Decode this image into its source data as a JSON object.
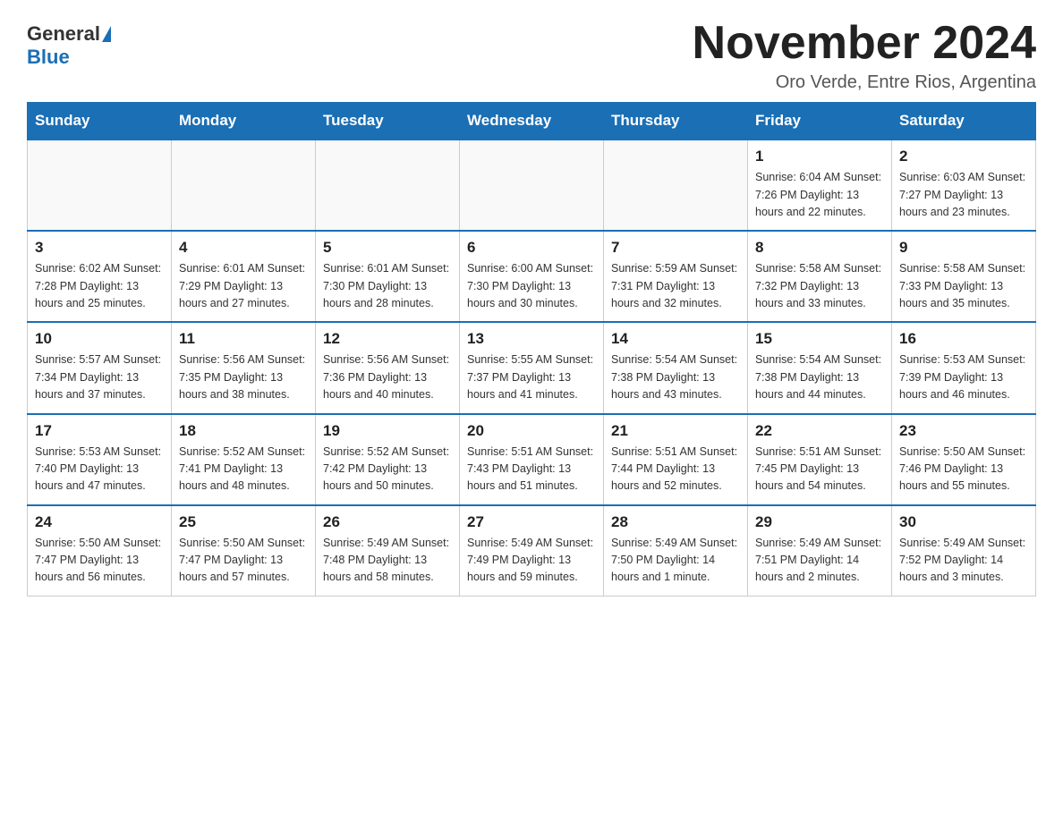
{
  "logo": {
    "general": "General",
    "blue": "Blue"
  },
  "title": "November 2024",
  "subtitle": "Oro Verde, Entre Rios, Argentina",
  "days_of_week": [
    "Sunday",
    "Monday",
    "Tuesday",
    "Wednesday",
    "Thursday",
    "Friday",
    "Saturday"
  ],
  "weeks": [
    [
      {
        "day": "",
        "info": ""
      },
      {
        "day": "",
        "info": ""
      },
      {
        "day": "",
        "info": ""
      },
      {
        "day": "",
        "info": ""
      },
      {
        "day": "",
        "info": ""
      },
      {
        "day": "1",
        "info": "Sunrise: 6:04 AM\nSunset: 7:26 PM\nDaylight: 13 hours and 22 minutes."
      },
      {
        "day": "2",
        "info": "Sunrise: 6:03 AM\nSunset: 7:27 PM\nDaylight: 13 hours and 23 minutes."
      }
    ],
    [
      {
        "day": "3",
        "info": "Sunrise: 6:02 AM\nSunset: 7:28 PM\nDaylight: 13 hours and 25 minutes."
      },
      {
        "day": "4",
        "info": "Sunrise: 6:01 AM\nSunset: 7:29 PM\nDaylight: 13 hours and 27 minutes."
      },
      {
        "day": "5",
        "info": "Sunrise: 6:01 AM\nSunset: 7:30 PM\nDaylight: 13 hours and 28 minutes."
      },
      {
        "day": "6",
        "info": "Sunrise: 6:00 AM\nSunset: 7:30 PM\nDaylight: 13 hours and 30 minutes."
      },
      {
        "day": "7",
        "info": "Sunrise: 5:59 AM\nSunset: 7:31 PM\nDaylight: 13 hours and 32 minutes."
      },
      {
        "day": "8",
        "info": "Sunrise: 5:58 AM\nSunset: 7:32 PM\nDaylight: 13 hours and 33 minutes."
      },
      {
        "day": "9",
        "info": "Sunrise: 5:58 AM\nSunset: 7:33 PM\nDaylight: 13 hours and 35 minutes."
      }
    ],
    [
      {
        "day": "10",
        "info": "Sunrise: 5:57 AM\nSunset: 7:34 PM\nDaylight: 13 hours and 37 minutes."
      },
      {
        "day": "11",
        "info": "Sunrise: 5:56 AM\nSunset: 7:35 PM\nDaylight: 13 hours and 38 minutes."
      },
      {
        "day": "12",
        "info": "Sunrise: 5:56 AM\nSunset: 7:36 PM\nDaylight: 13 hours and 40 minutes."
      },
      {
        "day": "13",
        "info": "Sunrise: 5:55 AM\nSunset: 7:37 PM\nDaylight: 13 hours and 41 minutes."
      },
      {
        "day": "14",
        "info": "Sunrise: 5:54 AM\nSunset: 7:38 PM\nDaylight: 13 hours and 43 minutes."
      },
      {
        "day": "15",
        "info": "Sunrise: 5:54 AM\nSunset: 7:38 PM\nDaylight: 13 hours and 44 minutes."
      },
      {
        "day": "16",
        "info": "Sunrise: 5:53 AM\nSunset: 7:39 PM\nDaylight: 13 hours and 46 minutes."
      }
    ],
    [
      {
        "day": "17",
        "info": "Sunrise: 5:53 AM\nSunset: 7:40 PM\nDaylight: 13 hours and 47 minutes."
      },
      {
        "day": "18",
        "info": "Sunrise: 5:52 AM\nSunset: 7:41 PM\nDaylight: 13 hours and 48 minutes."
      },
      {
        "day": "19",
        "info": "Sunrise: 5:52 AM\nSunset: 7:42 PM\nDaylight: 13 hours and 50 minutes."
      },
      {
        "day": "20",
        "info": "Sunrise: 5:51 AM\nSunset: 7:43 PM\nDaylight: 13 hours and 51 minutes."
      },
      {
        "day": "21",
        "info": "Sunrise: 5:51 AM\nSunset: 7:44 PM\nDaylight: 13 hours and 52 minutes."
      },
      {
        "day": "22",
        "info": "Sunrise: 5:51 AM\nSunset: 7:45 PM\nDaylight: 13 hours and 54 minutes."
      },
      {
        "day": "23",
        "info": "Sunrise: 5:50 AM\nSunset: 7:46 PM\nDaylight: 13 hours and 55 minutes."
      }
    ],
    [
      {
        "day": "24",
        "info": "Sunrise: 5:50 AM\nSunset: 7:47 PM\nDaylight: 13 hours and 56 minutes."
      },
      {
        "day": "25",
        "info": "Sunrise: 5:50 AM\nSunset: 7:47 PM\nDaylight: 13 hours and 57 minutes."
      },
      {
        "day": "26",
        "info": "Sunrise: 5:49 AM\nSunset: 7:48 PM\nDaylight: 13 hours and 58 minutes."
      },
      {
        "day": "27",
        "info": "Sunrise: 5:49 AM\nSunset: 7:49 PM\nDaylight: 13 hours and 59 minutes."
      },
      {
        "day": "28",
        "info": "Sunrise: 5:49 AM\nSunset: 7:50 PM\nDaylight: 14 hours and 1 minute."
      },
      {
        "day": "29",
        "info": "Sunrise: 5:49 AM\nSunset: 7:51 PM\nDaylight: 14 hours and 2 minutes."
      },
      {
        "day": "30",
        "info": "Sunrise: 5:49 AM\nSunset: 7:52 PM\nDaylight: 14 hours and 3 minutes."
      }
    ]
  ]
}
